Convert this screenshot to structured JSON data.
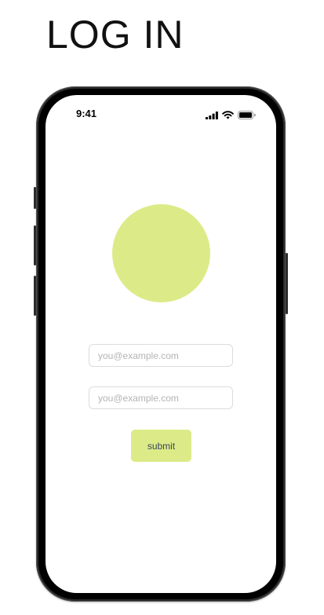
{
  "page": {
    "title": "LOG IN"
  },
  "status_bar": {
    "time": "9:41",
    "icons": [
      "cellular-signal-icon",
      "wifi-icon",
      "battery-icon"
    ]
  },
  "login_form": {
    "email_field": {
      "value": "",
      "placeholder": "you@example.com"
    },
    "second_field": {
      "value": "",
      "placeholder": "you@example.com"
    },
    "submit_label": "submit"
  },
  "colors": {
    "accent": "#dceb88",
    "button_text": "#3b4660",
    "phone_frame": "#2b2b2b",
    "field_border": "#dcdcdc",
    "placeholder": "#b4b4b4"
  }
}
